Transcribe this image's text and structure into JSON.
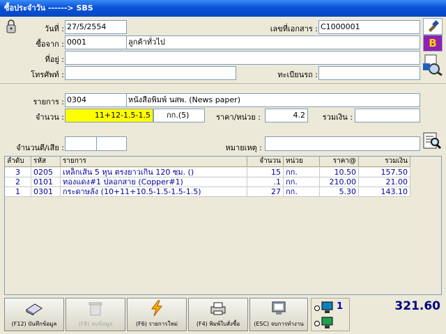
{
  "window": {
    "title": "ซื้อประจำวัน ------> SBS"
  },
  "header": {
    "date_label": "วันที่ :",
    "date_value": "27/5/2554",
    "doc_no_label": "เลขที่เอกสาร :",
    "doc_no_value": "C1000001",
    "from_label": "ซื้อจาก :",
    "from_code": "0001",
    "from_name": "ลูกค้าทั่วไป",
    "address_label": "ที่อยู่ :",
    "address_value": "",
    "phone_label": "โทรศัพท์ :",
    "phone_value": "",
    "plate_label": "ทะเบียนรถ :",
    "plate_value": ""
  },
  "item": {
    "item_label": "รายการ :",
    "item_code": "0304",
    "item_name": "หนังสือพิมพ์ นสพ. (News paper)",
    "qty_label": "จำนวน :",
    "qty_value": "11+12-1.5-1.5",
    "unit_value": "กก.(5)",
    "price_label": "ราคา/หน่วย :",
    "price_value": "4.2",
    "sum_label": "รวมเงิน :",
    "sum_value": "",
    "defect_label": "จำนวนตี/เสีย :",
    "defect_value1": "",
    "defect_value2": "",
    "note_label": "หมายเหตุ :",
    "note_value": ""
  },
  "grid": {
    "columns": [
      "ลำดับ",
      "รหัส",
      "รายการ",
      "จำนวน",
      "หน่วย",
      "ราคา@",
      "รวมเงิน"
    ],
    "rows": [
      [
        "3",
        "0205",
        "เหล็กเส้น 5 หุน ตรงยาวเกิน 120 ซม. ()",
        "15",
        "กก.",
        "10.50",
        "157.50"
      ],
      [
        "2",
        "0101",
        "ทองแดง#1 ปลอกสาย (Copper#1)",
        ".1",
        "กก.",
        "210.00",
        "21.00"
      ],
      [
        "1",
        "0301",
        "กระดาษลัง (10+11+10.5-1.5-1.5-1.5)",
        "27",
        "กก.",
        "5.30",
        "143.10"
      ]
    ]
  },
  "buttons": {
    "save": "(F12) บันทึกข้อมูล",
    "delete": "(F8) ลบข้อมูล",
    "new": "(F6) รายการใหม่",
    "print": "(F4) พิมพ์ใบสั่งซื้อ",
    "exit": "(ESC) จบการทำงาน"
  },
  "status": {
    "computer_no": "1",
    "total": "321.60"
  },
  "side_buttons": {
    "b_label": "B"
  }
}
